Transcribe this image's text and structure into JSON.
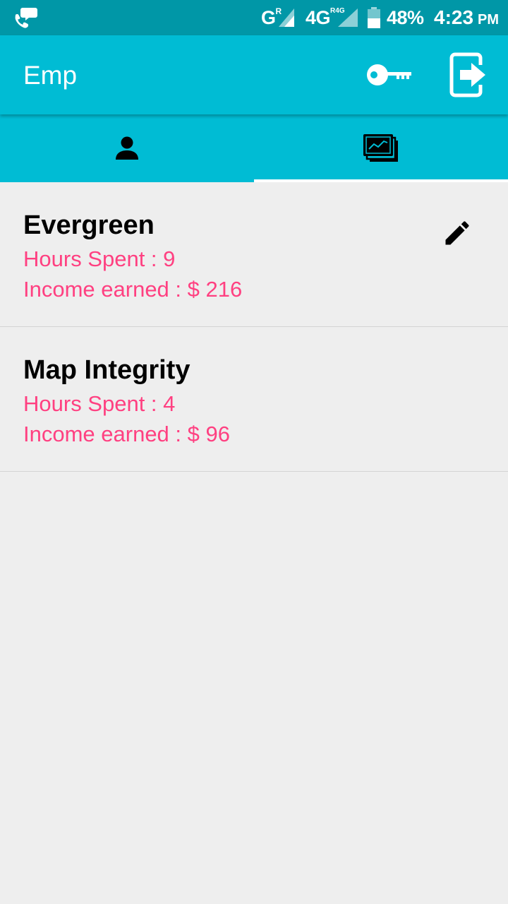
{
  "status_bar": {
    "network_1": "G",
    "network_1_sup": "R",
    "network_2": "4G",
    "network_2_sup": "R4G",
    "battery": "48%",
    "time": "4:23",
    "ampm": "PM"
  },
  "app_bar": {
    "title": "Emp"
  },
  "tabs": {
    "selected_index": 1
  },
  "projects": [
    {
      "name": "Evergreen",
      "hours": "Hours Spent : 9",
      "income": "Income earned : $ 216"
    },
    {
      "name": "Map Integrity",
      "hours": "Hours Spent : 4",
      "income": "Income earned : $ 96"
    }
  ],
  "colors": {
    "status_bar": "#0097a7",
    "primary": "#00bcd4",
    "accent": "#ff4081",
    "background": "#eeeeee"
  }
}
